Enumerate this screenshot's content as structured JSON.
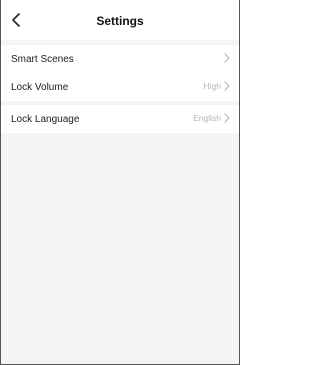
{
  "header": {
    "title": "Settings"
  },
  "groups": [
    {
      "items": [
        {
          "label": "Smart Scenes",
          "value": ""
        },
        {
          "label": "Lock Volume",
          "value": "High"
        }
      ]
    },
    {
      "items": [
        {
          "label": "Lock Language",
          "value": "English"
        }
      ]
    }
  ],
  "icons": {
    "back": "chevron-left-icon",
    "row_arrow": "chevron-right-icon"
  },
  "colors": {
    "page_background": "#f4f4f4",
    "card_background": "#ffffff",
    "secondary_text": "#b4b4b4"
  }
}
